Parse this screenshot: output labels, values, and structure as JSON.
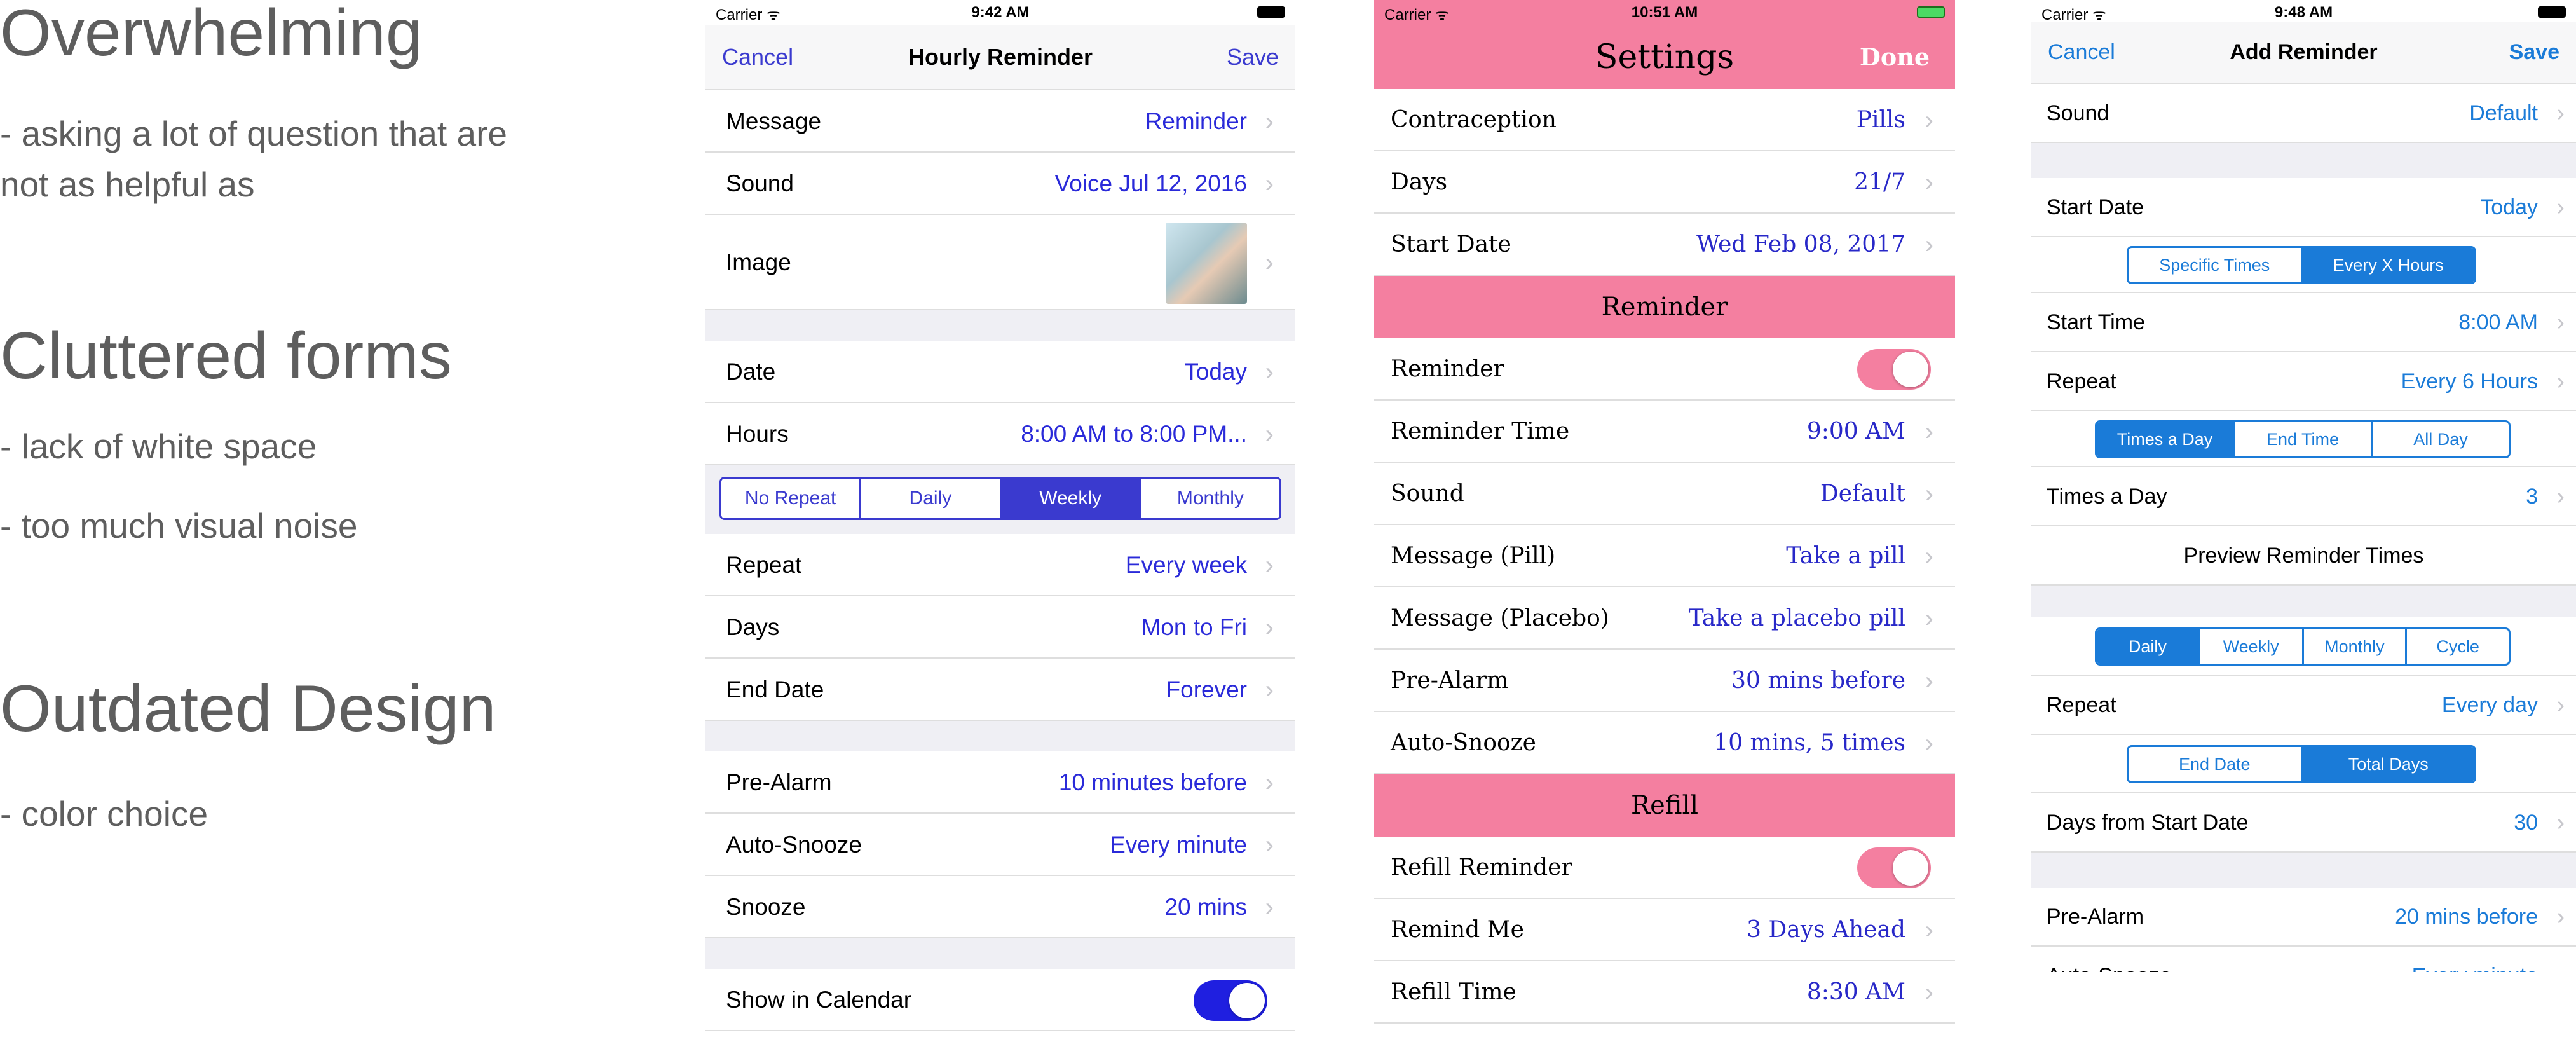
{
  "notes": [
    {
      "title": "Overwhelming",
      "lines": [
        "- asking a lot of question that are",
        "not as helpful as"
      ]
    },
    {
      "title": "Cluttered forms",
      "lines": [
        "- lack of white space",
        "- too much visual noise"
      ]
    },
    {
      "title": "Outdated Design",
      "lines": [
        "- color choice"
      ]
    }
  ],
  "phone1": {
    "status": {
      "carrier": "Carrier ᯤ",
      "time": "9:42 AM"
    },
    "nav": {
      "cancel": "Cancel",
      "title": "Hourly Reminder",
      "save": "Save"
    },
    "rows": [
      {
        "label": "Message",
        "value": "Reminder"
      },
      {
        "label": "Sound",
        "value": "Voice Jul 12, 2016"
      },
      {
        "label": "Image",
        "value": ""
      },
      {
        "label": "Date",
        "value": "Today"
      },
      {
        "label": "Hours",
        "value": "8:00 AM to 8:00 PM..."
      },
      {
        "label": "Repeat",
        "value": "Every week"
      },
      {
        "label": "Days",
        "value": "Mon to Fri"
      },
      {
        "label": "End Date",
        "value": "Forever"
      },
      {
        "label": "Pre-Alarm",
        "value": "10 minutes before"
      },
      {
        "label": "Auto-Snooze",
        "value": "Every minute"
      },
      {
        "label": "Snooze",
        "value": "20 mins"
      },
      {
        "label": "Show in Calendar",
        "value": ""
      }
    ],
    "segment": {
      "options": [
        "No Repeat",
        "Daily",
        "Weekly",
        "Monthly"
      ],
      "selected": "Weekly"
    },
    "toggle_show_in_calendar": true,
    "accent": "#2a2ad9"
  },
  "phone2": {
    "status": {
      "carrier": "Carrier ᯤ",
      "time": "10:51 AM"
    },
    "nav": {
      "title": "Settings",
      "done": "Done"
    },
    "rows_top": [
      {
        "label": "Contraception",
        "value": "Pills"
      },
      {
        "label": "Days",
        "value": "21/7"
      },
      {
        "label": "Start Date",
        "value": "Wed Feb 08, 2017"
      }
    ],
    "section_reminder": "Reminder",
    "rows_reminder": [
      {
        "label": "Reminder",
        "value": ""
      },
      {
        "label": "Reminder Time",
        "value": "9:00 AM"
      },
      {
        "label": "Sound",
        "value": "Default"
      },
      {
        "label": "Message (Pill)",
        "value": "Take a pill"
      },
      {
        "label": "Message (Placebo)",
        "value": "Take a placebo pill"
      },
      {
        "label": "Pre-Alarm",
        "value": "30 mins before"
      },
      {
        "label": "Auto-Snooze",
        "value": "10 mins, 5 times"
      }
    ],
    "section_refill": "Refill",
    "rows_refill": [
      {
        "label": "Refill Reminder",
        "value": ""
      },
      {
        "label": "Remind Me",
        "value": "3 Days Ahead"
      },
      {
        "label": "Refill Time",
        "value": "8:30 AM"
      }
    ],
    "toggle_reminder": true,
    "toggle_refill": true,
    "accent": "#f47fa0"
  },
  "phone3": {
    "status": {
      "carrier": "Carrier ᯤ",
      "time": "9:48 AM"
    },
    "nav": {
      "cancel": "Cancel",
      "title": "Add Reminder",
      "save": "Save"
    },
    "rows": [
      {
        "label": "Sound",
        "value": "Default"
      },
      {
        "label": "Start Date",
        "value": "Today"
      },
      {
        "label": "Start Time",
        "value": "8:00 AM"
      },
      {
        "label": "Repeat",
        "value": "Every 6 Hours"
      },
      {
        "label": "Times a Day",
        "value": "3"
      },
      {
        "label": "Preview Reminder Times",
        "value": ""
      },
      {
        "label": "Repeat",
        "value": "Every day"
      },
      {
        "label": "Days from Start Date",
        "value": "30"
      },
      {
        "label": "Pre-Alarm",
        "value": "20 mins before"
      },
      {
        "label": "Auto-Snooze",
        "value": "Every minute"
      }
    ],
    "seg_times": {
      "options": [
        "Specific Times",
        "Every X Hours"
      ],
      "selected": "Every X Hours"
    },
    "seg_daymode": {
      "options": [
        "Times a Day",
        "End Time",
        "All Day"
      ],
      "selected": "Times a Day"
    },
    "seg_period": {
      "options": [
        "Daily",
        "Weekly",
        "Monthly",
        "Cycle"
      ],
      "selected": "Daily"
    },
    "seg_end": {
      "options": [
        "End Date",
        "Total Days"
      ],
      "selected": "Total Days"
    },
    "accent": "#1a7bd8"
  }
}
